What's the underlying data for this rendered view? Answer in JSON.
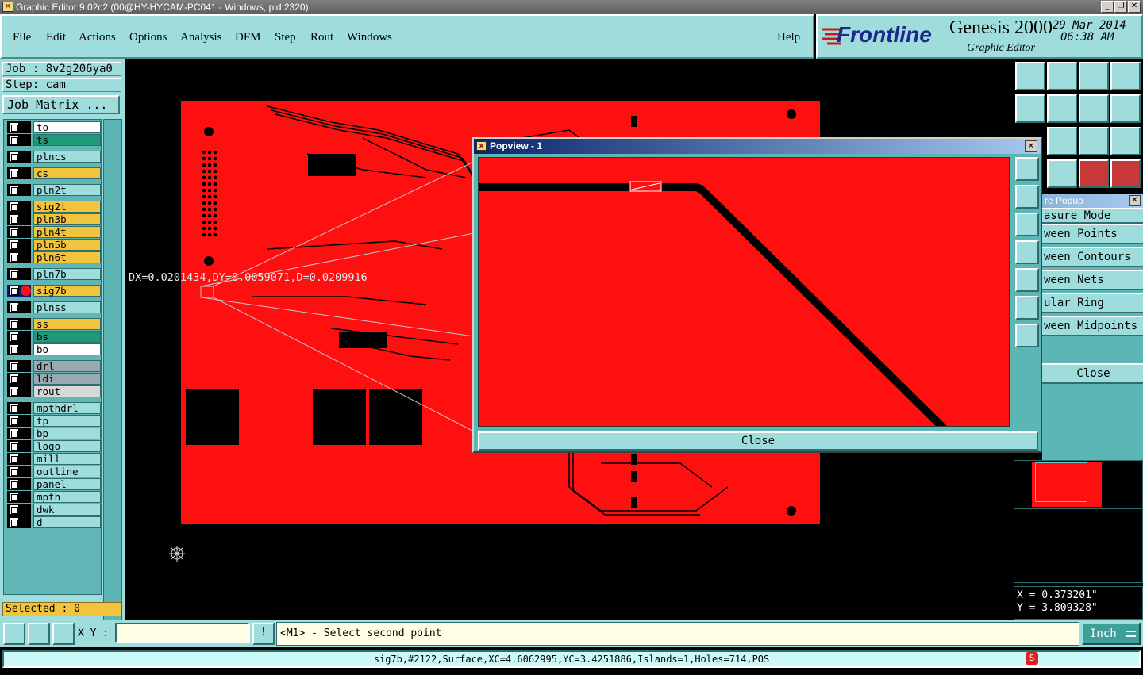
{
  "window": {
    "title": "Graphic Editor 9.02c2 (00@HY-HYCAM-PC041 - Windows, pid:2320)"
  },
  "menu": {
    "items": [
      {
        "label": "File"
      },
      {
        "label": "Edit"
      },
      {
        "label": "Actions"
      },
      {
        "label": "Options"
      },
      {
        "label": "Analysis"
      },
      {
        "label": "DFM"
      },
      {
        "label": "Step"
      },
      {
        "label": "Rout"
      },
      {
        "label": "Windows"
      }
    ],
    "help": "Help"
  },
  "brand": {
    "logo": "Frontline",
    "product": "Genesis 2000",
    "subtitle": "Graphic Editor",
    "date": "29 Mar 2014",
    "time": "06:38 AM"
  },
  "job": {
    "job_label": "Job : 8v2g206ya0",
    "step_label": "Step: cam",
    "matrix_button": "Job Matrix ..."
  },
  "layers": [
    {
      "name": "to",
      "color": "#ffffff"
    },
    {
      "name": "ts",
      "color": "#1e9a78"
    },
    {
      "name": "plncs",
      "color": "#9fdcdc"
    },
    {
      "name": "cs",
      "color": "#f2c33c"
    },
    {
      "name": "pln2t",
      "color": "#9fdcdc"
    },
    {
      "name": "sig2t",
      "color": "#f2c33c"
    },
    {
      "name": "pln3b",
      "color": "#f2c33c"
    },
    {
      "name": "pln4t",
      "color": "#f2c33c"
    },
    {
      "name": "pln5b",
      "color": "#f2c33c"
    },
    {
      "name": "pln6t",
      "color": "#f2c33c"
    },
    {
      "name": "pln7b",
      "color": "#9fdcdc"
    },
    {
      "name": "sig7b",
      "color": "#f2c33c",
      "active": true
    },
    {
      "name": "plnss",
      "color": "#9fdcdc"
    },
    {
      "name": "ss",
      "color": "#f2c33c"
    },
    {
      "name": "bs",
      "color": "#1e9a78"
    },
    {
      "name": "bo",
      "color": "#ffffff"
    },
    {
      "name": "drl",
      "color": "#9aa8b0"
    },
    {
      "name": "ldi",
      "color": "#9aa8b0"
    },
    {
      "name": "rout",
      "color": "#d8d8d8"
    },
    {
      "name": "mpthdrl",
      "color": "#9fdcdc"
    },
    {
      "name": "tp",
      "color": "#9fdcdc"
    },
    {
      "name": "bp",
      "color": "#9fdcdc"
    },
    {
      "name": "logo",
      "color": "#9fdcdc"
    },
    {
      "name": "mill",
      "color": "#9fdcdc"
    },
    {
      "name": "outline",
      "color": "#9fdcdc"
    },
    {
      "name": "panel",
      "color": "#9fdcdc"
    },
    {
      "name": "mpth",
      "color": "#9fdcdc"
    },
    {
      "name": "dwk",
      "color": "#9fdcdc"
    },
    {
      "name": "d",
      "color": "#9fdcdc"
    }
  ],
  "selected": "Selected : 0",
  "measurement": "DX=0.0201434,DY=0.0059071,D=0.0209916",
  "popview": {
    "title": "Popview - 1",
    "close": "Close"
  },
  "measure_popup": {
    "title": "re Popup",
    "items": [
      "asure Mode",
      "ween Points",
      "ween Contours",
      "ween Nets",
      "ular Ring",
      "ween Midpoints"
    ],
    "close": "Close"
  },
  "coords": {
    "x": "X = 0.373201\"",
    "y": "Y = 3.809328\""
  },
  "command": {
    "xy_label": "X Y :",
    "xy_value": "",
    "prompt": "<M1> - Select second point",
    "unit": "Inch"
  },
  "status": "sig7b,#2122,Surface,XC=4.6062995,YC=3.4251886,Islands=1,Holes=714,POS"
}
